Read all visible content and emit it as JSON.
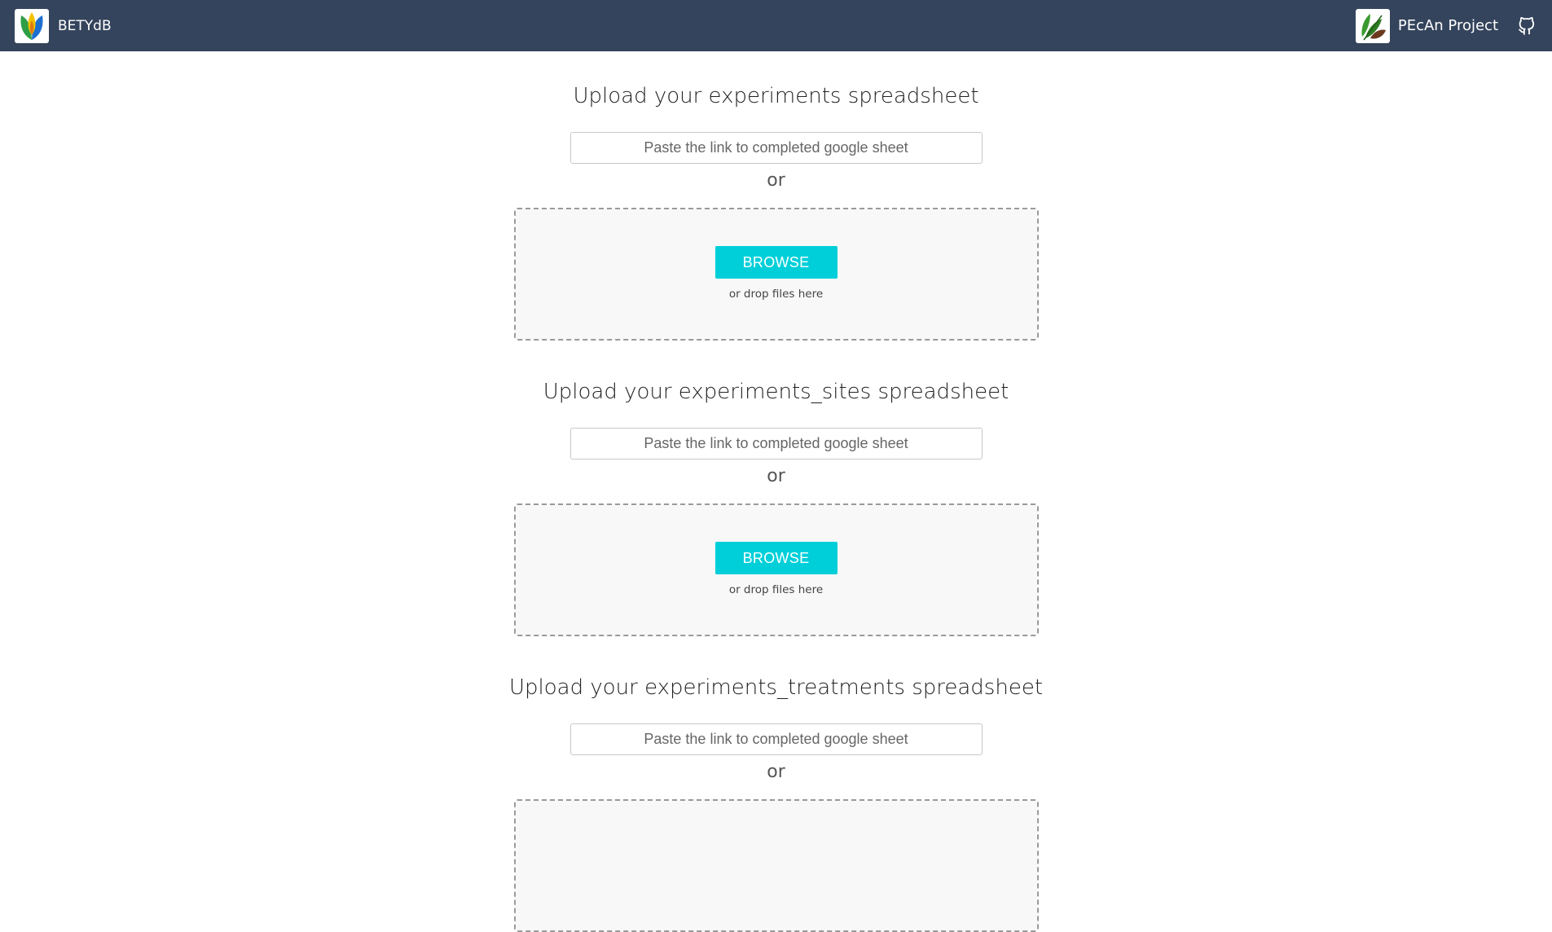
{
  "navbar": {
    "brand_name": "BETYdB",
    "brand_logo_icon": "betydb-leaf-logo-icon",
    "pecan_name": "PEcAn Project",
    "pecan_logo_icon": "pecan-leaves-logo-icon",
    "github_icon": "github-icon",
    "background_color": "#34445c"
  },
  "sections": [
    {
      "title": "Upload your experiments spreadsheet",
      "link_placeholder": "Paste the link to completed google sheet",
      "or_label": "or",
      "browse_label": "BROWSE",
      "drop_hint": "or drop files here"
    },
    {
      "title": "Upload your experiments_sites spreadsheet",
      "link_placeholder": "Paste the link to completed google sheet",
      "or_label": "or",
      "browse_label": "BROWSE",
      "drop_hint": "or drop files here"
    },
    {
      "title": "Upload your experiments_treatments spreadsheet",
      "link_placeholder": "Paste the link to completed google sheet",
      "or_label": "or"
    }
  ],
  "colors": {
    "accent": "#00cfd9",
    "dropzone_bg": "#f8f8f8"
  }
}
